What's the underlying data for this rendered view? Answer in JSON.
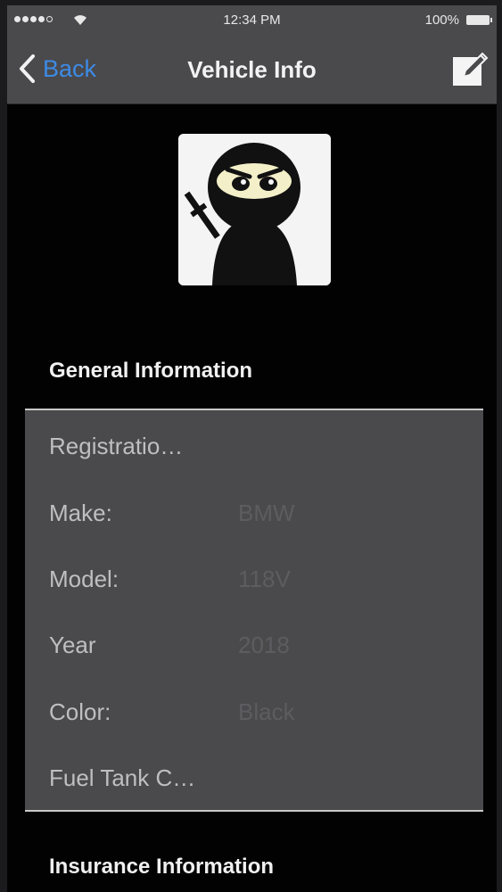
{
  "status_bar": {
    "time": "12:34 PM",
    "battery": "100%"
  },
  "nav": {
    "back_label": "Back",
    "title": "Vehicle Info",
    "edit_icon": "edit-icon"
  },
  "avatar": {
    "icon": "ninja-avatar"
  },
  "general_section": {
    "title": "General Information",
    "rows": [
      {
        "label": "Registratio…",
        "value": ""
      },
      {
        "label": "Make:",
        "value": "BMW"
      },
      {
        "label": "Model:",
        "value": "118V"
      },
      {
        "label": "Year",
        "value": "2018"
      },
      {
        "label": "Color:",
        "value": "Black"
      },
      {
        "label": "Fuel Tank C…",
        "value": ""
      }
    ]
  },
  "insurance_section": {
    "title": "Insurance Information"
  },
  "colors": {
    "accent": "#3d8be6",
    "bar_bg": "#4a494c",
    "screen_bg": "#020203"
  }
}
